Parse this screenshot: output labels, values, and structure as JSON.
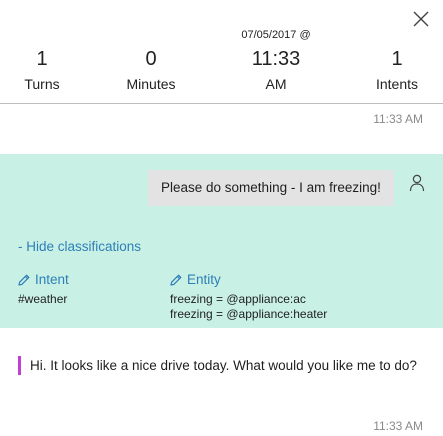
{
  "stats": {
    "turns": {
      "value": "1",
      "label": "Turns"
    },
    "minutes": {
      "value": "0",
      "label": "Minutes"
    },
    "time": {
      "date": "07/05/2017 @",
      "value": "11:33",
      "label": "AM"
    },
    "intents": {
      "value": "1",
      "label": "Intents"
    }
  },
  "user_message": {
    "timestamp": "11:33 AM",
    "text": "Please do something - I am freezing!"
  },
  "classifications": {
    "toggle_label": "- Hide classifications",
    "intent_header": "Intent",
    "intent_value": "#weather",
    "entity_header": "Entity",
    "entity_values": [
      "freezing = @appliance:ac",
      "freezing = @appliance:heater"
    ]
  },
  "bot_message": {
    "text": "Hi. It looks like a nice drive today. What would you like me to do?",
    "timestamp": "11:33 AM"
  },
  "colors": {
    "accent": "#2c7fb8",
    "user_section_bg": "#c9f0e4",
    "bot_bar": "#c23fd3"
  },
  "icons": {
    "close": "close-icon",
    "user": "user-icon",
    "edit": "pencil-icon"
  }
}
